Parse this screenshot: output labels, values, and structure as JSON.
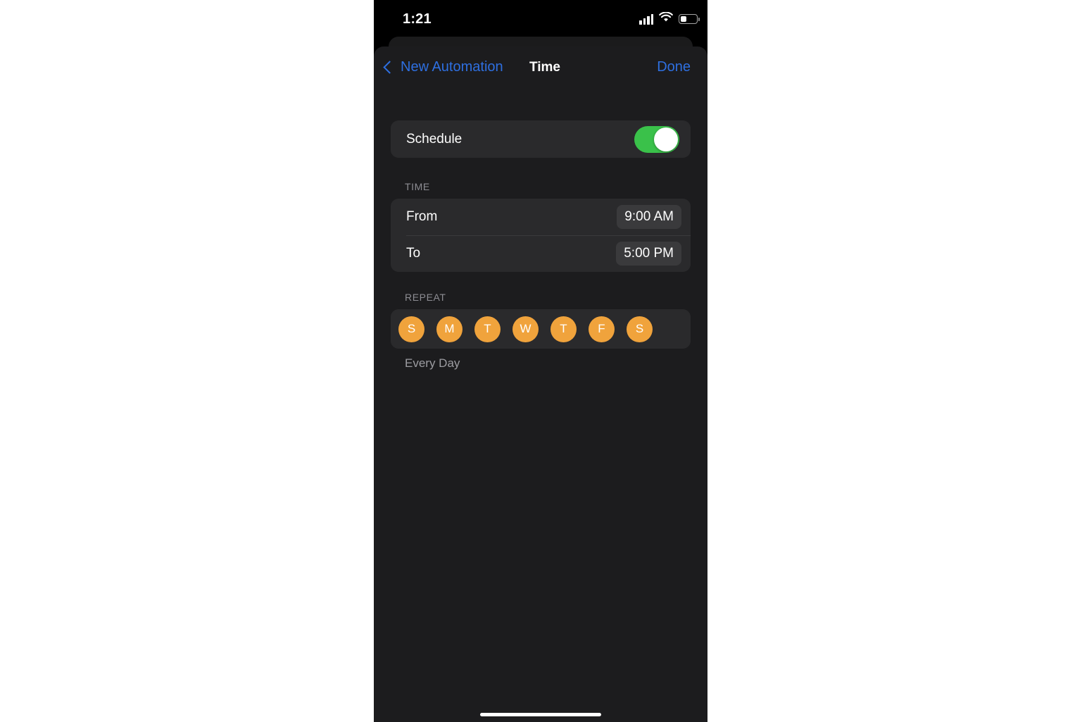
{
  "status_bar": {
    "time": "1:21",
    "cellular_icon": "cellular-signal-icon",
    "wifi_icon": "wifi-icon",
    "battery_icon": "battery-icon",
    "battery_level_percent": 38
  },
  "nav_bar": {
    "back_label": "New Automation",
    "back_icon": "chevron-left-icon",
    "title": "Time",
    "done_label": "Done",
    "accent_color": "#2e6fe0"
  },
  "schedule": {
    "label": "Schedule",
    "toggle_on": true,
    "toggle_on_color": "#3ac14a"
  },
  "time_section": {
    "header": "TIME",
    "rows": [
      {
        "label": "From",
        "value": "9:00 AM"
      },
      {
        "label": "To",
        "value": "5:00 PM"
      }
    ]
  },
  "repeat_section": {
    "header": "REPEAT",
    "selected_color": "#f0a33c",
    "days": [
      {
        "letter": "S",
        "name": "sunday",
        "selected": true
      },
      {
        "letter": "M",
        "name": "monday",
        "selected": true
      },
      {
        "letter": "T",
        "name": "tuesday",
        "selected": true
      },
      {
        "letter": "W",
        "name": "wednesday",
        "selected": true
      },
      {
        "letter": "T",
        "name": "thursday",
        "selected": true
      },
      {
        "letter": "F",
        "name": "friday",
        "selected": true
      },
      {
        "letter": "S",
        "name": "saturday",
        "selected": true
      }
    ],
    "summary": "Every Day"
  },
  "colors": {
    "background": "#1c1c1e",
    "card": "#2a2a2c",
    "chip": "#3a3a3c"
  }
}
